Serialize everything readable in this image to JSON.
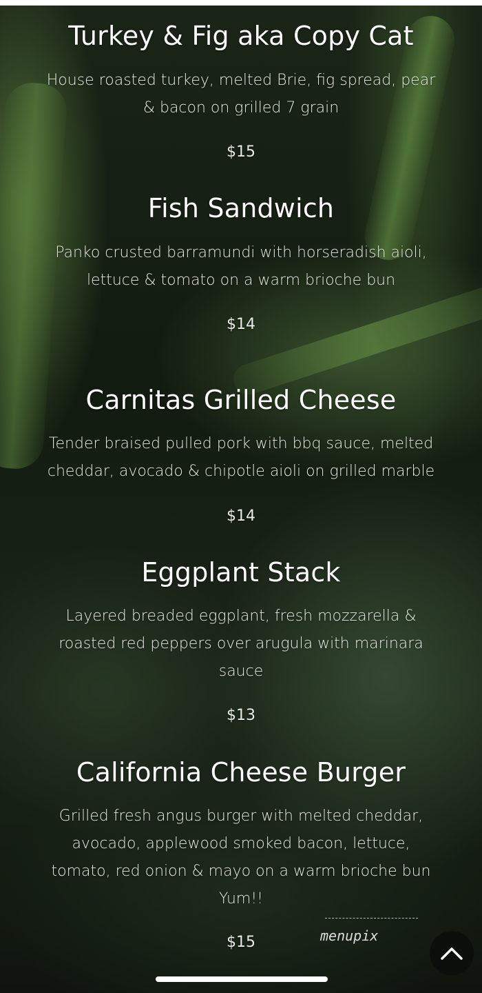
{
  "menu": {
    "items": [
      {
        "name": "Turkey & Fig aka Copy Cat",
        "desc_lines": [
          "House roasted turkey, melted Brie, fig spread, pear",
          "& bacon on grilled 7 grain"
        ],
        "price": "$15"
      },
      {
        "name": "Fish Sandwich",
        "desc_lines": [
          "Panko crusted barramundi with horseradish aioli,",
          "lettuce & tomato on a warm brioche bun"
        ],
        "price": "$14"
      },
      {
        "name": "Carnitas Grilled Cheese",
        "desc_lines": [
          "Tender braised pulled pork with bbq sauce, melted",
          "cheddar, avocado & chipotle aioli on grilled marble"
        ],
        "price": "$14"
      },
      {
        "name": "Eggplant Stack",
        "desc_lines": [
          "Layered breaded eggplant, fresh mozzarella &",
          "roasted red peppers over arugula with marinara",
          "sauce"
        ],
        "price": "$13"
      },
      {
        "name": "California Cheese Burger",
        "desc_lines": [
          "Grilled fresh angus burger with melted cheddar,",
          "avocado, applewood smoked bacon, lettuce,",
          "tomato, red onion & mayo on a warm brioche bun",
          "Yum!!"
        ],
        "price": "$15"
      }
    ]
  },
  "watermark": {
    "text": "menupix"
  },
  "controls": {
    "scroll_top_icon": "chevron-up-icon"
  },
  "colors": {
    "text": "#ffffff",
    "background": "#121b10"
  }
}
